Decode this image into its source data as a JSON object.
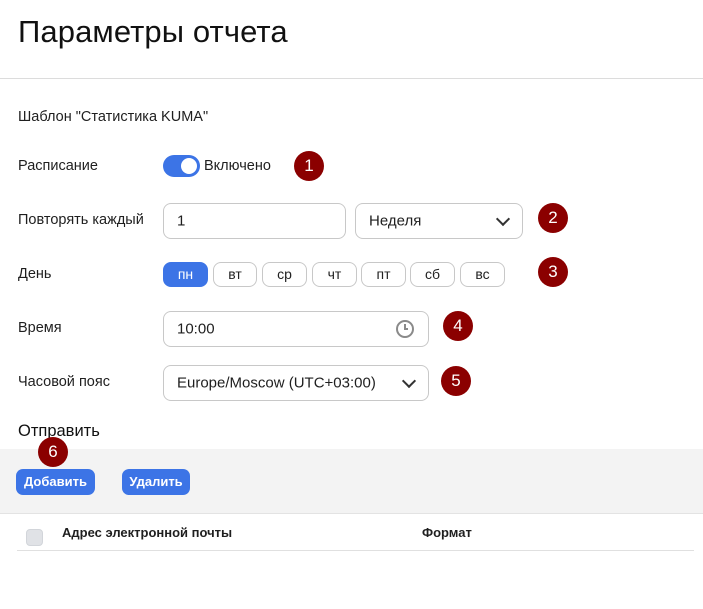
{
  "page": {
    "title": "Параметры отчета"
  },
  "template": {
    "text": "Шаблон \"Статистика KUMA\""
  },
  "schedule": {
    "label": "Расписание",
    "toggle_text": "Включено",
    "enabled": true
  },
  "repeat": {
    "label": "Повторять каждый",
    "value": "1",
    "unit": "Неделя"
  },
  "day": {
    "label": "День",
    "options": [
      "пн",
      "вт",
      "ср",
      "чт",
      "пт",
      "сб",
      "вс"
    ],
    "selected": "пн"
  },
  "time": {
    "label": "Время",
    "value": "10:00"
  },
  "timezone": {
    "label": "Часовой пояс",
    "value": "Europe/Moscow (UTC+03:00)"
  },
  "send": {
    "heading": "Отправить",
    "add_label": "Добавить",
    "delete_label": "Удалить"
  },
  "table": {
    "columns": [
      "Адрес электронной почты",
      "Формат"
    ]
  },
  "annotations": [
    "1",
    "2",
    "3",
    "4",
    "5",
    "6"
  ],
  "colors": {
    "accent": "#3c74e6",
    "badge": "#8b0000"
  }
}
